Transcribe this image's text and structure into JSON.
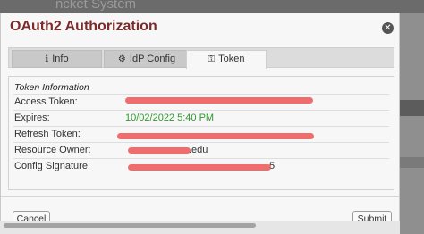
{
  "background": {
    "partial_text": "ncket System"
  },
  "dialog": {
    "title": "OAuth2 Authorization",
    "close_icon": "close-circle-icon"
  },
  "tabs": [
    {
      "label": "Info",
      "icon": "info-icon",
      "active": false
    },
    {
      "label": "IdP Config",
      "icon": "gear-icon",
      "active": false
    },
    {
      "label": "Token",
      "icon": "key-icon",
      "active": true
    }
  ],
  "token_info": {
    "section_title": "Token Information",
    "rows": [
      {
        "label": "Access Token:",
        "value": "",
        "redacted": true
      },
      {
        "label": "Expires:",
        "value": "10/02/2022 5:40 PM",
        "redacted": false
      },
      {
        "label": "Refresh Token:",
        "value": "",
        "redacted": true
      },
      {
        "label": "Resource Owner:",
        "value": ".edu",
        "redacted": true
      },
      {
        "label": "Config Signature:",
        "value": "5",
        "redacted": true
      }
    ]
  },
  "buttons": {
    "cancel": "Cancel",
    "submit": "Submit"
  },
  "colors": {
    "title": "#7a2b2b",
    "expires_value": "#2e9a2e",
    "redaction": "#ee5555"
  }
}
